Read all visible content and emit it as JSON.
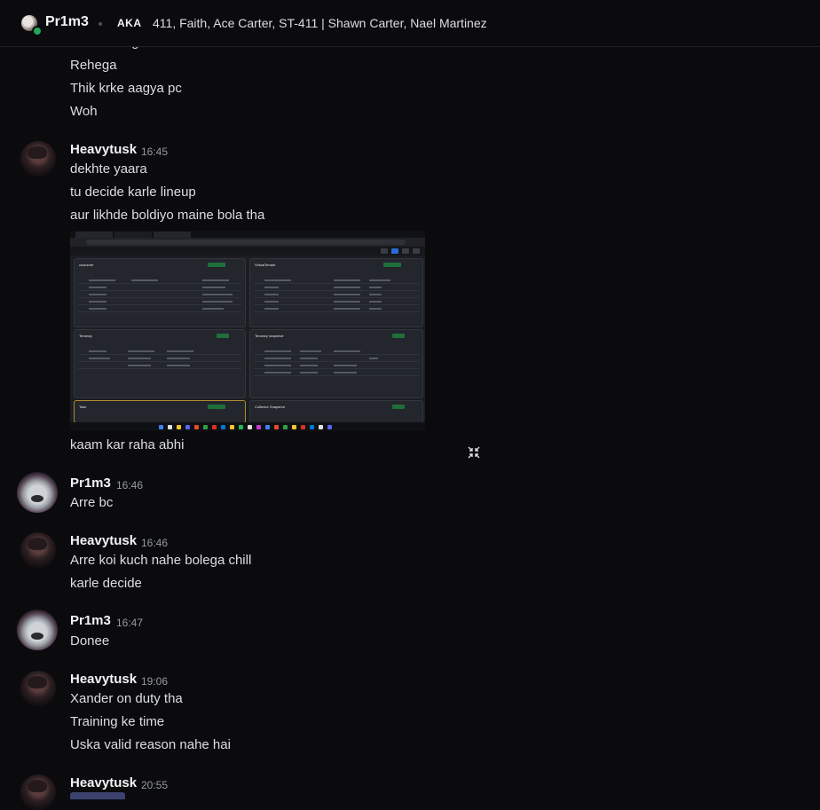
{
  "header": {
    "name": "Pr1m3",
    "aka_label": "AKA",
    "aliases": "411, Faith, Ace Carter, ST-411 | Shawn Carter, Nael Martinez"
  },
  "top_lines": [
    "Better bhega",
    "Rehega",
    "Thik krke aagya pc",
    "Woh"
  ],
  "messages": [
    {
      "author": "Heavytusk",
      "time": "16:45",
      "lines": [
        "dekhte yaara",
        "tu decide karle lineup",
        "aur likhde boldiyo maine bola tha"
      ],
      "after_image": "kaam kar raha abhi"
    },
    {
      "author": "Pr1m3",
      "time": "16:46",
      "lines": [
        "Arre bc"
      ]
    },
    {
      "author": "Heavytusk",
      "time": "16:46",
      "lines": [
        "Arre koi kuch nahe bolega chill",
        "karle decide"
      ]
    },
    {
      "author": "Pr1m3",
      "time": "16:47",
      "lines": [
        "Donee"
      ]
    },
    {
      "author": "Heavytusk",
      "time": "19:06",
      "lines": [
        "Xander on duty tha",
        "Training ke time",
        "Uska valid reason nahe hai"
      ]
    },
    {
      "author": "Heavytusk",
      "time": "20:55",
      "lines": []
    }
  ],
  "attachment": {
    "panels": [
      "customer",
      "VirtualTenant",
      "Tenancy",
      "Tenancy snapshot",
      "Task",
      "Collector Snapshot"
    ]
  },
  "colors": {
    "background": "#0b0b0d",
    "text": "#dbdee1",
    "timestamp": "#949ba4",
    "online": "#23a55a",
    "mention": "#3c4270"
  }
}
